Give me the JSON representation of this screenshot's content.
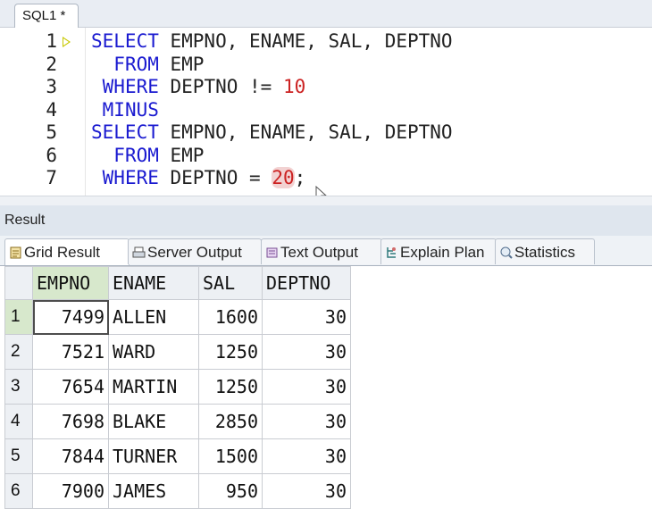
{
  "editor_tab": {
    "label": "SQL1 *"
  },
  "editor": {
    "lines": [
      {
        "number": "1",
        "parts": [
          [
            "kw",
            "SELECT"
          ],
          [
            "p",
            " EMPNO, ENAME, SAL, DEPTNO"
          ]
        ]
      },
      {
        "number": "2",
        "parts": [
          [
            "p",
            "  "
          ],
          [
            "kw",
            "FROM"
          ],
          [
            "p",
            " EMP"
          ]
        ]
      },
      {
        "number": "3",
        "parts": [
          [
            "p",
            " "
          ],
          [
            "kw",
            "WHERE"
          ],
          [
            "p",
            " DEPTNO != "
          ],
          [
            "num",
            "10"
          ]
        ]
      },
      {
        "number": "4",
        "parts": [
          [
            "p",
            " "
          ],
          [
            "kw",
            "MINUS"
          ]
        ]
      },
      {
        "number": "5",
        "parts": [
          [
            "kw",
            "SELECT"
          ],
          [
            "p",
            " EMPNO, ENAME, SAL, DEPTNO"
          ]
        ]
      },
      {
        "number": "6",
        "parts": [
          [
            "p",
            "  "
          ],
          [
            "kw",
            "FROM"
          ],
          [
            "p",
            " EMP"
          ]
        ]
      },
      {
        "number": "7",
        "parts": [
          [
            "p",
            " "
          ],
          [
            "kw",
            "WHERE"
          ],
          [
            "p",
            " DEPTNO = "
          ],
          [
            "numhl",
            "20"
          ],
          [
            "p",
            ";"
          ]
        ]
      }
    ]
  },
  "result_panel": {
    "title": "Result"
  },
  "result_tabs": [
    {
      "label": "Grid Result",
      "icon": "grid-icon",
      "active": true
    },
    {
      "label": "Server Output",
      "icon": "printer-icon",
      "active": false
    },
    {
      "label": "Text Output",
      "icon": "text-output-icon",
      "active": false
    },
    {
      "label": "Explain Plan",
      "icon": "explain-plan-icon",
      "active": false
    },
    {
      "label": "Statistics",
      "icon": "statistics-icon",
      "active": false
    }
  ],
  "grid": {
    "columns": [
      "EMPNO",
      "ENAME",
      "SAL",
      "DEPTNO"
    ],
    "rows": [
      {
        "n": "1",
        "cells": [
          "7499",
          "ALLEN",
          "1600",
          "30"
        ]
      },
      {
        "n": "2",
        "cells": [
          "7521",
          "WARD",
          "1250",
          "30"
        ]
      },
      {
        "n": "3",
        "cells": [
          "7654",
          "MARTIN",
          "1250",
          "30"
        ]
      },
      {
        "n": "4",
        "cells": [
          "7698",
          "BLAKE",
          "2850",
          "30"
        ]
      },
      {
        "n": "5",
        "cells": [
          "7844",
          "TURNER",
          "1500",
          "30"
        ]
      },
      {
        "n": "6",
        "cells": [
          "7900",
          "JAMES",
          "950",
          "30"
        ]
      }
    ]
  },
  "colors": {
    "keyword": "#1a1ad0",
    "number": "#cc2222",
    "selection": "#d7e8cc"
  }
}
